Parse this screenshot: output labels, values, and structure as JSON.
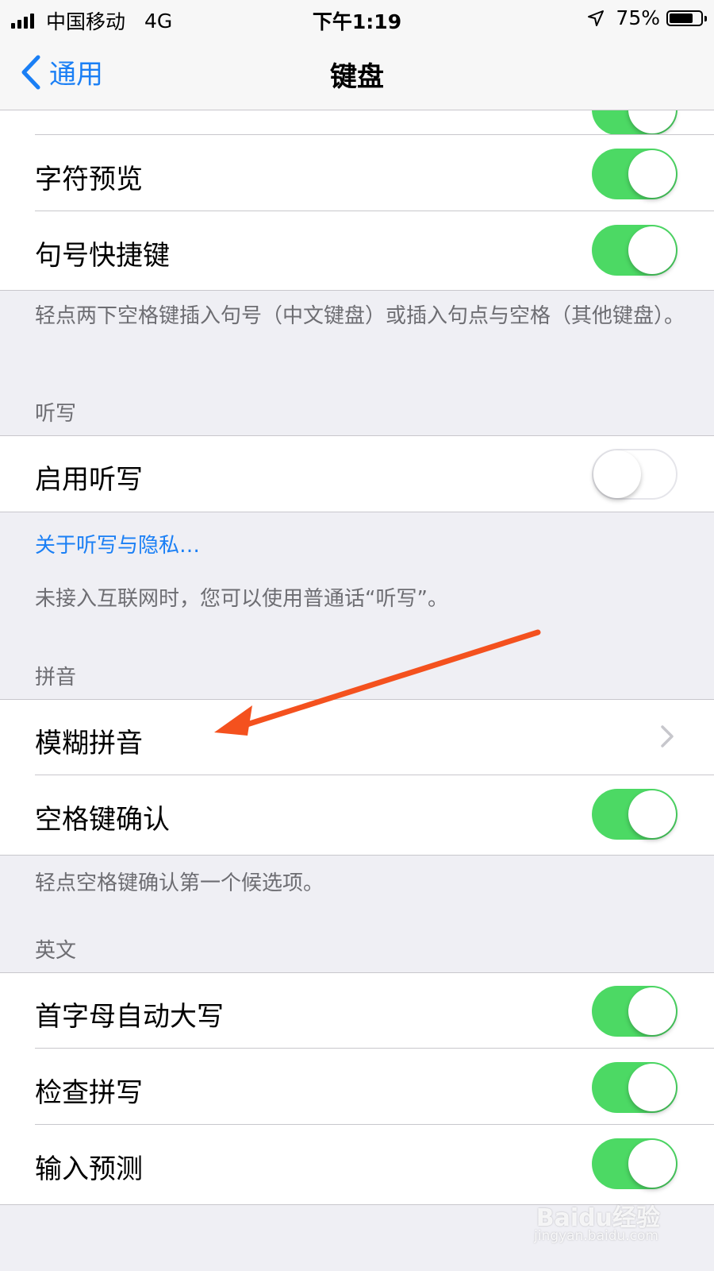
{
  "status_bar": {
    "carrier": "中国移动",
    "network": "4G",
    "time": "下午1:19",
    "battery": "75%",
    "battery_level": 0.75
  },
  "nav": {
    "back_label": "通用",
    "title": "键盘"
  },
  "group1": {
    "rows": [
      {
        "label": "字符预览",
        "toggle": "on"
      },
      {
        "label": "句号快捷键",
        "toggle": "on"
      }
    ],
    "footer": "轻点两下空格键插入句号（中文键盘）或插入句点与空格（其他键盘）。"
  },
  "dictation": {
    "header": "听写",
    "rows": [
      {
        "label": "启用听写",
        "toggle": "off"
      }
    ],
    "link": "关于听写与隐私…",
    "footer": "未接入互联网时，您可以使用普通话“听写”。"
  },
  "pinyin": {
    "header": "拼音",
    "rows": [
      {
        "label": "模糊拼音",
        "type": "disclosure"
      },
      {
        "label": "空格键确认",
        "toggle": "on"
      }
    ],
    "footer": "轻点空格键确认第一个候选项。"
  },
  "english": {
    "header": "英文",
    "rows": [
      {
        "label": "首字母自动大写",
        "toggle": "on"
      },
      {
        "label": "检查拼写",
        "toggle": "on"
      },
      {
        "label": "输入预测",
        "toggle": "on"
      }
    ]
  },
  "annotation_color": "#f4511e",
  "watermark": {
    "brand": "Baidu经验",
    "url": "jingyan.baidu.com"
  }
}
